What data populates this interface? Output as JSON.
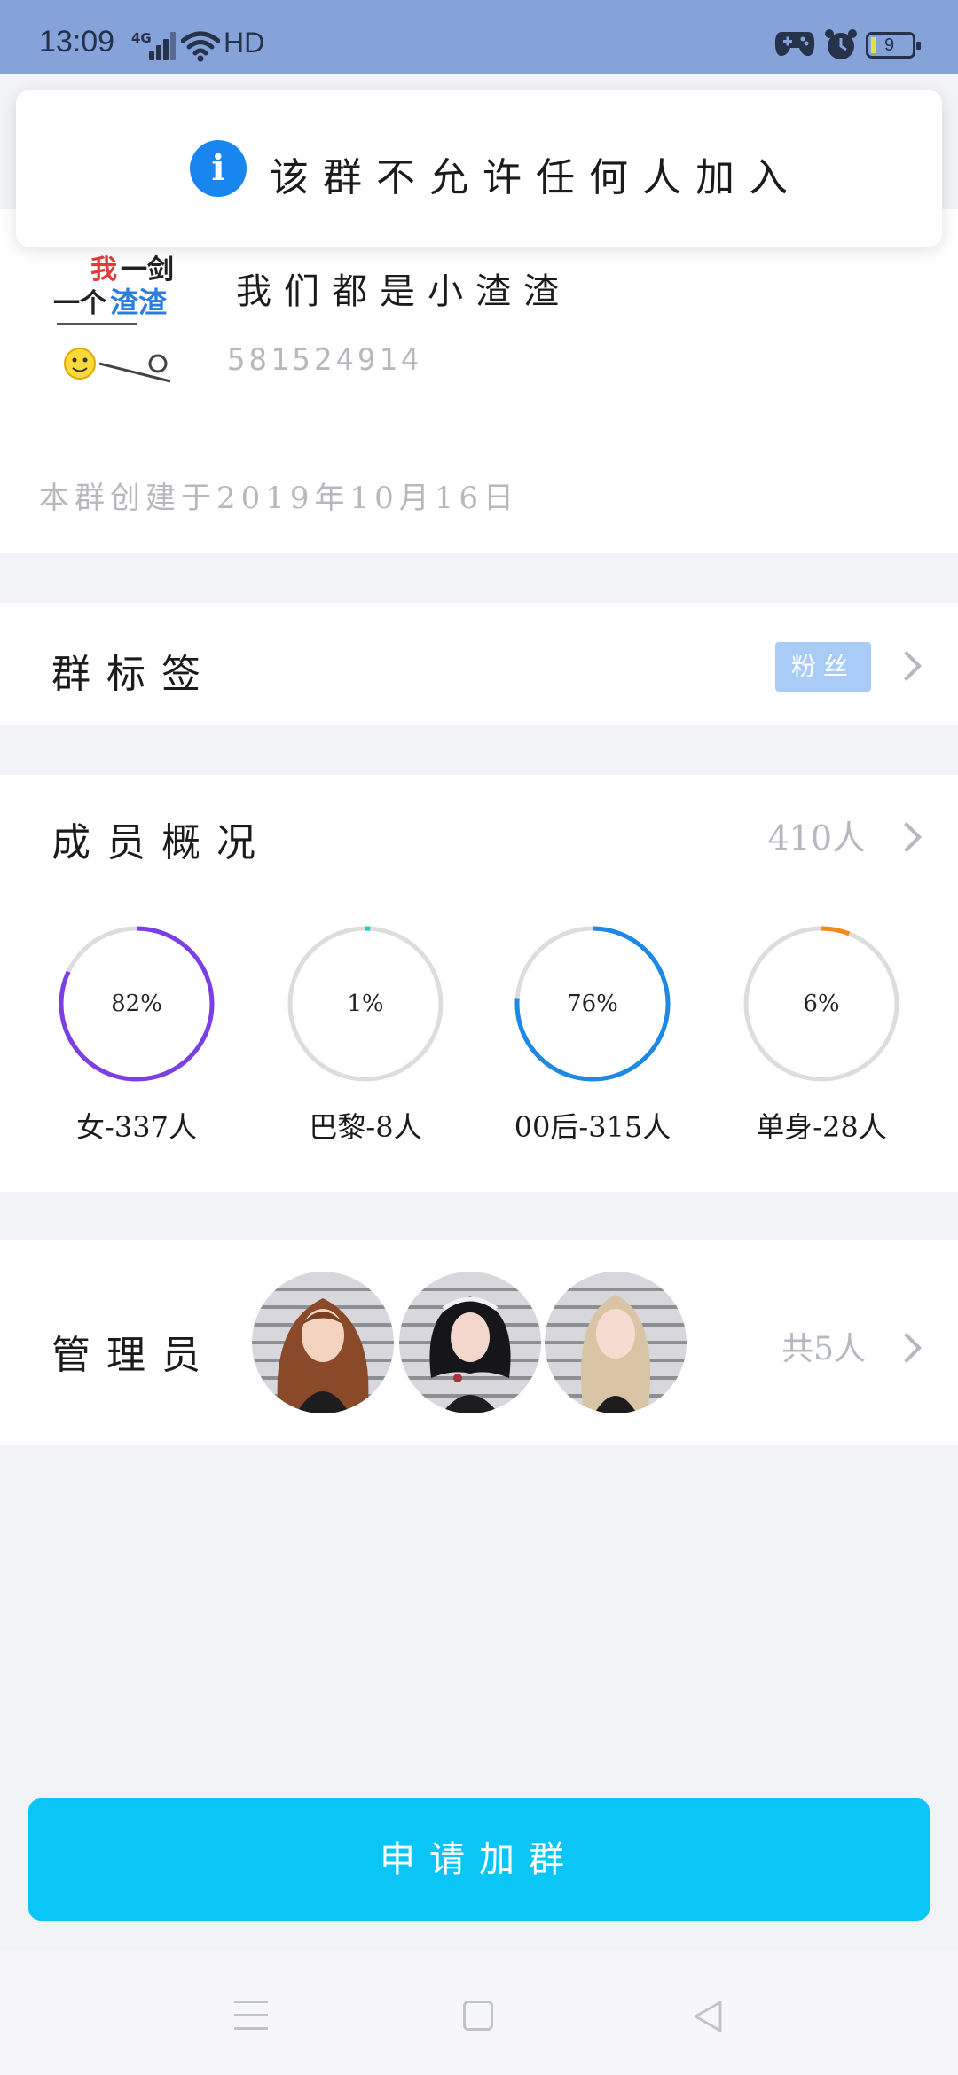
{
  "status_bar": {
    "time": "13:09",
    "network": "4G",
    "hd": "HD",
    "battery": "9"
  },
  "toast": {
    "message": "该群不允许任何人加入"
  },
  "group": {
    "name": "我们都是小渣渣",
    "id": "581524914",
    "created": "本群创建于2019年10月16日"
  },
  "tags": {
    "title": "群标签",
    "tag": "粉丝"
  },
  "members": {
    "title": "成员概况",
    "count": "410人",
    "stats": [
      {
        "pct_label": "82%",
        "value": 82,
        "label": "女-337人",
        "color": "#7b3fe4"
      },
      {
        "pct_label": "1%",
        "value": 1,
        "label": "巴黎-8人",
        "color": "#2cc6c0"
      },
      {
        "pct_label": "76%",
        "value": 76,
        "label": "00后-315人",
        "color": "#1e88e5"
      },
      {
        "pct_label": "6%",
        "value": 6,
        "label": "单身-28人",
        "color": "#f28a1e"
      }
    ]
  },
  "admins": {
    "title": "管理员",
    "count": "共5人",
    "avatars": [
      "avatar-brown-hair",
      "avatar-black-hair",
      "avatar-blonde-hair"
    ]
  },
  "apply_button": {
    "label": "申请加群"
  },
  "colors": {
    "status_bar": "#86a3d9",
    "accent": "#0ac6f7",
    "info": "#1985ee",
    "tag_bg": "#a8ccf6"
  }
}
